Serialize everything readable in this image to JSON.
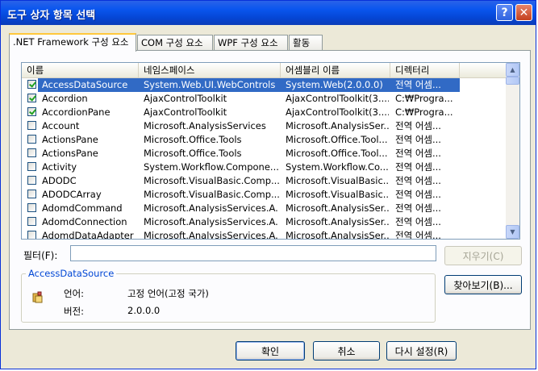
{
  "window": {
    "title": "도구 상자 항목 선택",
    "help": "?",
    "close": "✕"
  },
  "tabs": [
    {
      "label": ".NET Framework 구성 요소",
      "active": true
    },
    {
      "label": "COM 구성 요소"
    },
    {
      "label": "WPF 구성 요소"
    },
    {
      "label": "활동"
    }
  ],
  "list": {
    "columns": [
      "이름",
      "네임스페이스",
      "어셈블리 이름",
      "디렉터리"
    ],
    "rows": [
      {
        "checked": true,
        "selected": true,
        "name": "AccessDataSource",
        "ns": "System.Web.UI.WebControls",
        "asm": "System.Web(2.0.0.0)",
        "dir": "전역 어셈..."
      },
      {
        "checked": true,
        "name": "Accordion",
        "ns": "AjaxControlToolkit",
        "asm": "AjaxControlToolkit(3....",
        "dir": "C:₩Progra..."
      },
      {
        "checked": true,
        "name": "AccordionPane",
        "ns": "AjaxControlToolkit",
        "asm": "AjaxControlToolkit(3....",
        "dir": "C:₩Progra..."
      },
      {
        "checked": false,
        "name": "Account",
        "ns": "Microsoft.AnalysisServices",
        "asm": "Microsoft.AnalysisSer...",
        "dir": "전역 어셈..."
      },
      {
        "checked": false,
        "name": "ActionsPane",
        "ns": "Microsoft.Office.Tools",
        "asm": "Microsoft.Office.Tool...",
        "dir": "전역 어셈..."
      },
      {
        "checked": false,
        "name": "ActionsPane",
        "ns": "Microsoft.Office.Tools",
        "asm": "Microsoft.Office.Tool...",
        "dir": "전역 어셈..."
      },
      {
        "checked": false,
        "name": "Activity",
        "ns": "System.Workflow.Compone...",
        "asm": "System.Workflow.Co...",
        "dir": "전역 어셈..."
      },
      {
        "checked": false,
        "name": "ADODC",
        "ns": "Microsoft.VisualBasic.Comp...",
        "asm": "Microsoft.VisualBasic...",
        "dir": "전역 어셈..."
      },
      {
        "checked": false,
        "name": "ADODCArray",
        "ns": "Microsoft.VisualBasic.Comp...",
        "asm": "Microsoft.VisualBasic...",
        "dir": "전역 어셈..."
      },
      {
        "checked": false,
        "name": "AdomdCommand",
        "ns": "Microsoft.AnalysisServices.A...",
        "asm": "Microsoft.AnalysisSer...",
        "dir": "전역 어셈..."
      },
      {
        "checked": false,
        "name": "AdomdConnection",
        "ns": "Microsoft.AnalysisServices.A...",
        "asm": "Microsoft.AnalysisSer...",
        "dir": "전역 어셈..."
      },
      {
        "checked": false,
        "name": "AdomdDataAdapter",
        "ns": "Microsoft.AnalysisServices.A...",
        "asm": "Microsoft.AnalysisSer...",
        "dir": "전역 어셈..."
      }
    ]
  },
  "filter": {
    "label": "필터(F):",
    "value": "",
    "clear_label": "지우기(C)"
  },
  "details": {
    "group_title": "AccessDataSource",
    "language_label": "언어:",
    "language_value": "고정 언어(고정 국가)",
    "version_label": "버전:",
    "version_value": "2.0.0.0"
  },
  "browse_label": "찾아보기(B)...",
  "footer": {
    "ok": "확인",
    "cancel": "취소",
    "reset": "다시 설정(R)"
  }
}
